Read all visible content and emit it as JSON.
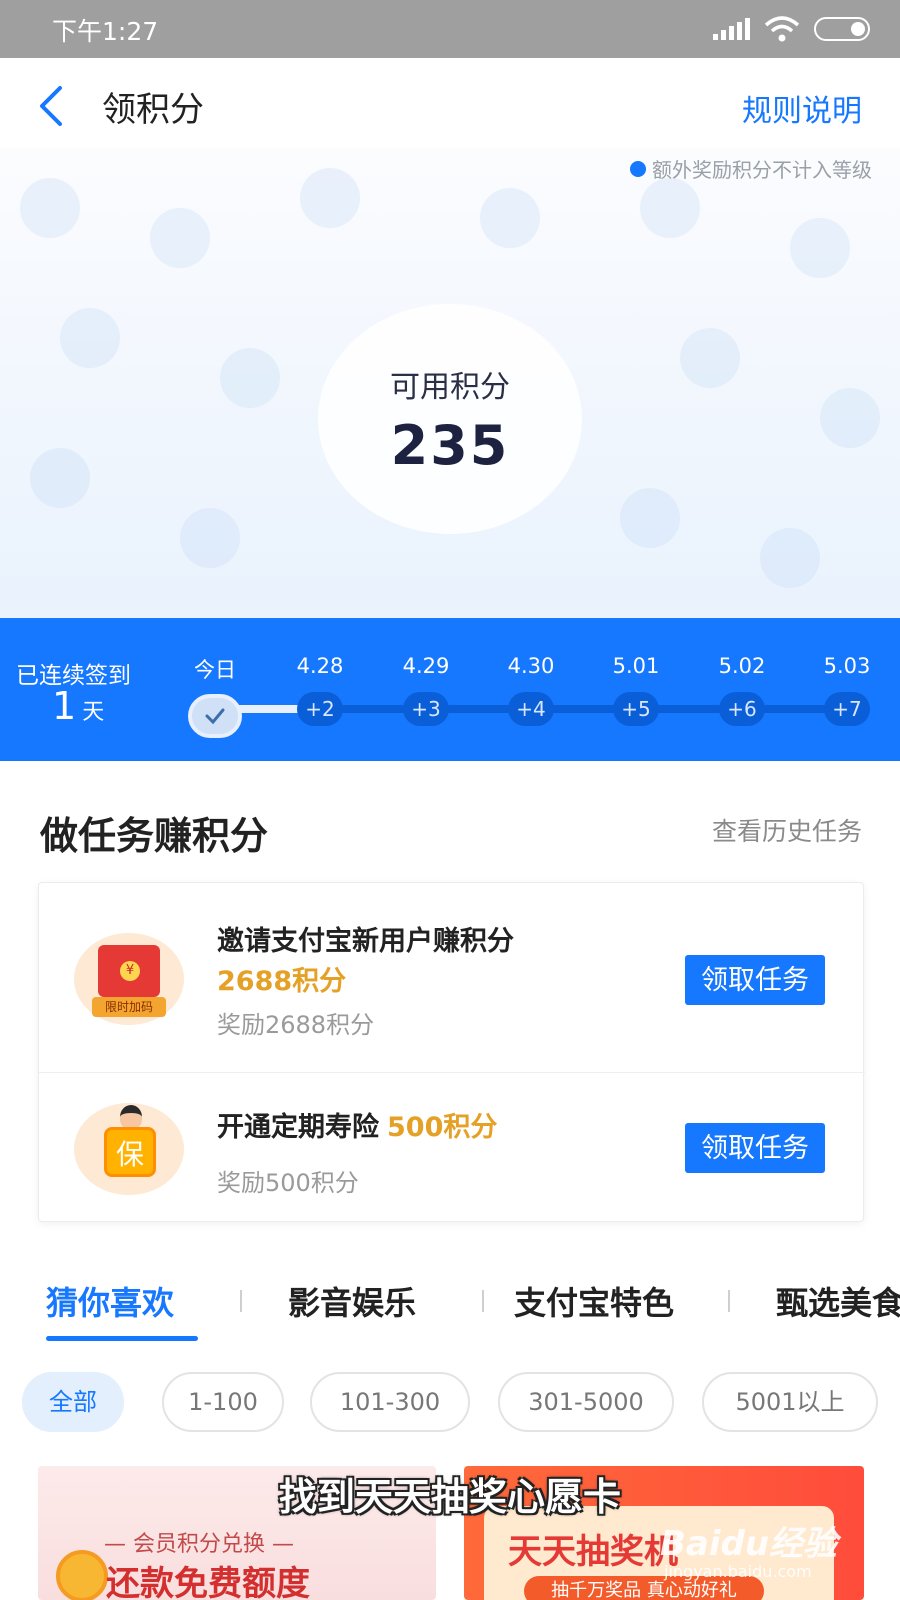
{
  "status_bar": {
    "time": "下午1:27"
  },
  "header": {
    "title": "领积分",
    "rules_link": "规则说明"
  },
  "hero": {
    "note": "额外奖励积分不计入等级",
    "points_label": "可用积分",
    "points_value": "235"
  },
  "sign_in": {
    "label": "已连续签到",
    "days_count": "1",
    "days_unit": "天",
    "days": [
      {
        "date": "今日",
        "reward": "",
        "done": true
      },
      {
        "date": "4.28",
        "reward": "+2"
      },
      {
        "date": "4.29",
        "reward": "+3"
      },
      {
        "date": "4.30",
        "reward": "+4"
      },
      {
        "date": "5.01",
        "reward": "+5"
      },
      {
        "date": "5.02",
        "reward": "+6"
      },
      {
        "date": "5.03",
        "reward": "+7"
      }
    ]
  },
  "tasks": {
    "title": "做任务赚积分",
    "history_link": "查看历史任务",
    "items": [
      {
        "name": "邀请支付宝新用户赚积分",
        "points": "2688积分",
        "reward": "奖励2688积分",
        "button": "领取任务",
        "icon_badge": "限时加码"
      },
      {
        "name": "开通定期寿险",
        "points": "500积分",
        "reward": "奖励500积分",
        "button": "领取任务",
        "icon_badge": "保"
      }
    ]
  },
  "categories": {
    "tabs": [
      "猜你喜欢",
      "影音娱乐",
      "支付宝特色",
      "甄选美食"
    ],
    "active_tab": 0,
    "filters": [
      "全部",
      "1-100",
      "101-300",
      "301-5000",
      "5001以上"
    ],
    "active_filter": 0
  },
  "banners": {
    "left": {
      "sub": "— 会员积分兑换 —",
      "main": "还款免费额度"
    },
    "right": {
      "main": "天天抽奖机",
      "sub": "抽千万奖品 真心动好礼"
    }
  },
  "caption": "找到天天抽奖心愿卡",
  "watermark": {
    "logo": "Baidu经验",
    "url": "jingyan.baidu.com"
  },
  "colors": {
    "accent": "#1677ff",
    "gold": "#e5a126",
    "status_bar": "#9f9f9f"
  }
}
